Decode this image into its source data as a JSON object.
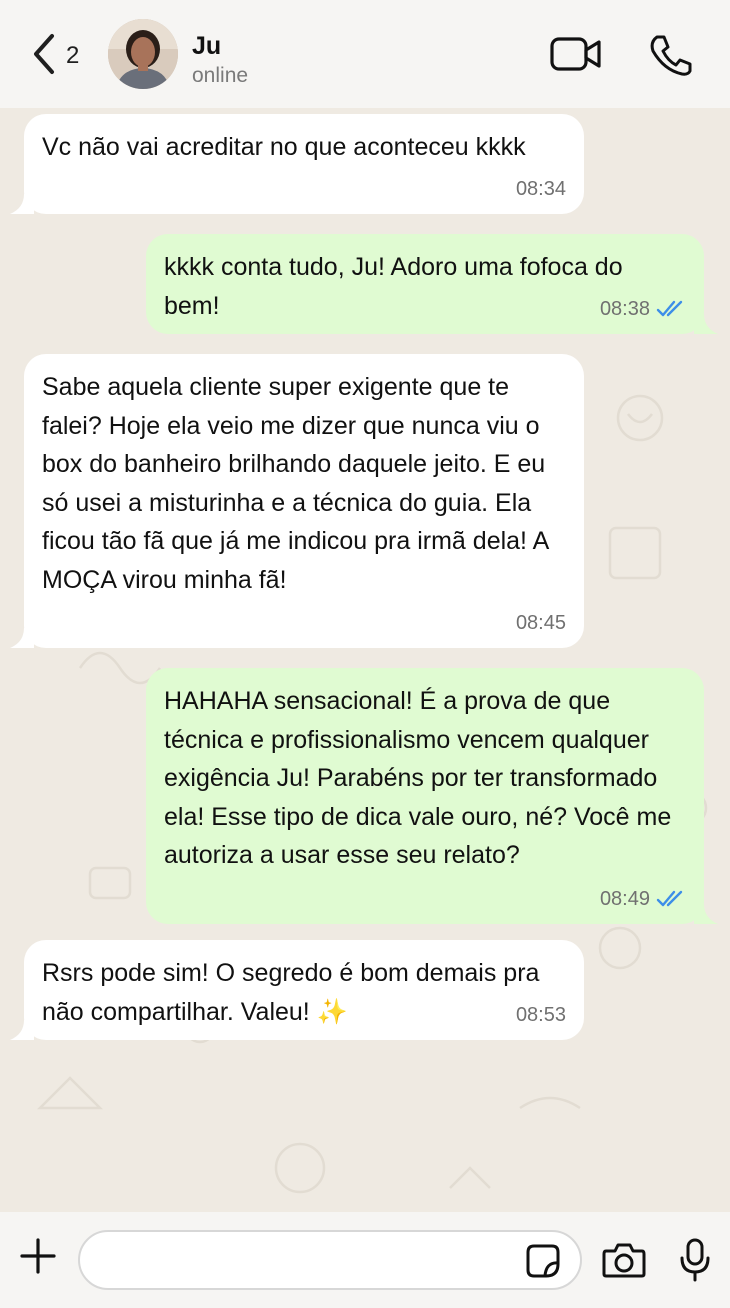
{
  "header": {
    "back_count": "2",
    "contact_name": "Ju",
    "contact_status": "online"
  },
  "messages": [
    {
      "direction": "incoming",
      "text": "Vc não vai acreditar no que aconteceu kkkk",
      "time": "08:34"
    },
    {
      "direction": "outgoing",
      "text": "kkkk conta tudo, Ju! Adoro uma fofoca do bem!",
      "time": "08:38",
      "status": "read"
    },
    {
      "direction": "incoming",
      "text": "Sabe aquela cliente super exigente que te falei? Hoje ela veio me dizer que nunca viu o box do banheiro brilhando daquele jeito. E eu só usei a misturinha e a técnica do guia. Ela ficou tão fã que já me indicou pra irmã dela! A MOÇA virou minha fã!",
      "time": "08:45"
    },
    {
      "direction": "outgoing",
      "text": "HAHAHA sensacional! É a prova de que técnica e profissionalismo vencem qualquer exigência Ju! Parabéns por ter transformado ela! Esse tipo de dica vale ouro, né? Você me autoriza a usar esse seu relato?",
      "time": "08:49",
      "status": "read"
    },
    {
      "direction": "incoming",
      "text": "Rsrs pode sim! O segredo é bom demais pra não compartilhar. Valeu! ✨",
      "time": "08:53"
    }
  ],
  "composer": {
    "value": "",
    "placeholder": ""
  },
  "colors": {
    "chat_bg": "#efeae2",
    "incoming_bubble": "#ffffff",
    "outgoing_bubble": "#e0fbd2",
    "read_ticks": "#3d8ee8",
    "header_bg": "#f6f5f3"
  },
  "icons": [
    "chevron-left-icon",
    "video-camera-icon",
    "phone-icon",
    "plus-icon",
    "sticker-icon",
    "camera-icon",
    "microphone-icon",
    "double-check-icon"
  ]
}
